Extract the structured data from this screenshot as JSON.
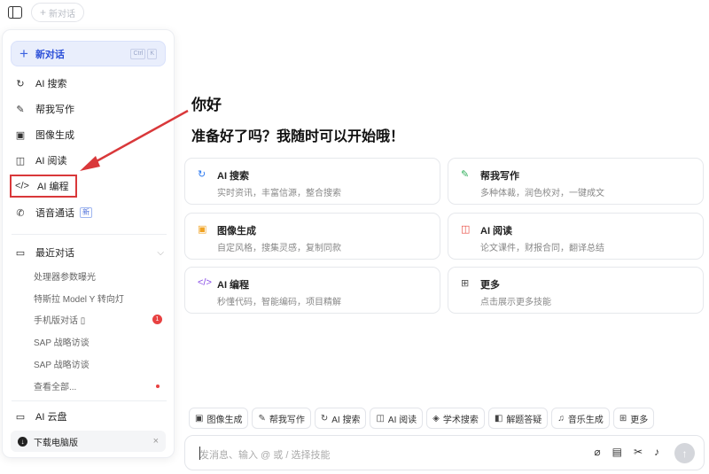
{
  "topbar": {
    "new_chat_label": "新对话"
  },
  "sidebar": {
    "new_chat": {
      "label": "新对话",
      "shortcut": [
        "Ctrl",
        "K"
      ]
    },
    "nav_items": [
      {
        "label": "AI 搜索",
        "icon": "search-refresh-icon"
      },
      {
        "label": "帮我写作",
        "icon": "magic-pen-icon"
      },
      {
        "label": "图像生成",
        "icon": "image-icon"
      },
      {
        "label": "AI 阅读",
        "icon": "book-icon"
      },
      {
        "label": "AI 编程",
        "icon": "code-icon"
      },
      {
        "label": "语音通话",
        "icon": "phone-icon",
        "badge": "新"
      }
    ],
    "recent": {
      "title": "最近对话",
      "items": [
        {
          "label": "处理器参数曝光"
        },
        {
          "label": "特斯拉 Model Y 转向灯"
        },
        {
          "label": "手机版对话 ▯",
          "count": "1"
        },
        {
          "label": "SAP 战略访谈"
        },
        {
          "label": "SAP 战略访谈"
        },
        {
          "label": "查看全部..."
        }
      ]
    },
    "cloud_label": "AI 云盘",
    "download_label": "下载电脑版"
  },
  "main": {
    "greeting": "你好",
    "subtitle": "准备好了吗？我随时可以开始哦！",
    "cards": [
      {
        "title": "AI 搜索",
        "desc": "实时资讯，丰富信源，整合搜索",
        "icon": "search-refresh-icon",
        "color": "#2f7bf0"
      },
      {
        "title": "帮我写作",
        "desc": "多种体裁，润色校对，一键成文",
        "icon": "magic-pen-icon",
        "color": "#2fae5a"
      },
      {
        "title": "图像生成",
        "desc": "自定风格，搜集灵感，复制同款",
        "icon": "image-icon",
        "color": "#f0a323"
      },
      {
        "title": "AI 阅读",
        "desc": "论文课件，财报合同，翻译总结",
        "icon": "book-icon",
        "color": "#e8483f"
      },
      {
        "title": "AI 编程",
        "desc": "秒懂代码，智能编码，项目精解",
        "icon": "code-icon",
        "color": "#8a4fe6"
      },
      {
        "title": "更多",
        "desc": "点击展示更多技能",
        "icon": "grid-icon",
        "color": "#555555"
      }
    ],
    "chips": [
      {
        "label": "图像生成",
        "icon": "image-icon"
      },
      {
        "label": "帮我写作",
        "icon": "magic-pen-icon"
      },
      {
        "label": "AI 搜索",
        "icon": "search-refresh-icon"
      },
      {
        "label": "AI 阅读",
        "icon": "book-icon"
      },
      {
        "label": "学术搜索",
        "icon": "academic-icon"
      },
      {
        "label": "解题答疑",
        "icon": "question-icon"
      },
      {
        "label": "音乐生成",
        "icon": "music-icon"
      },
      {
        "label": "更多",
        "icon": "grid-icon"
      }
    ],
    "composer": {
      "placeholder": "发消息、输入 @ 或 / 选择技能"
    }
  }
}
